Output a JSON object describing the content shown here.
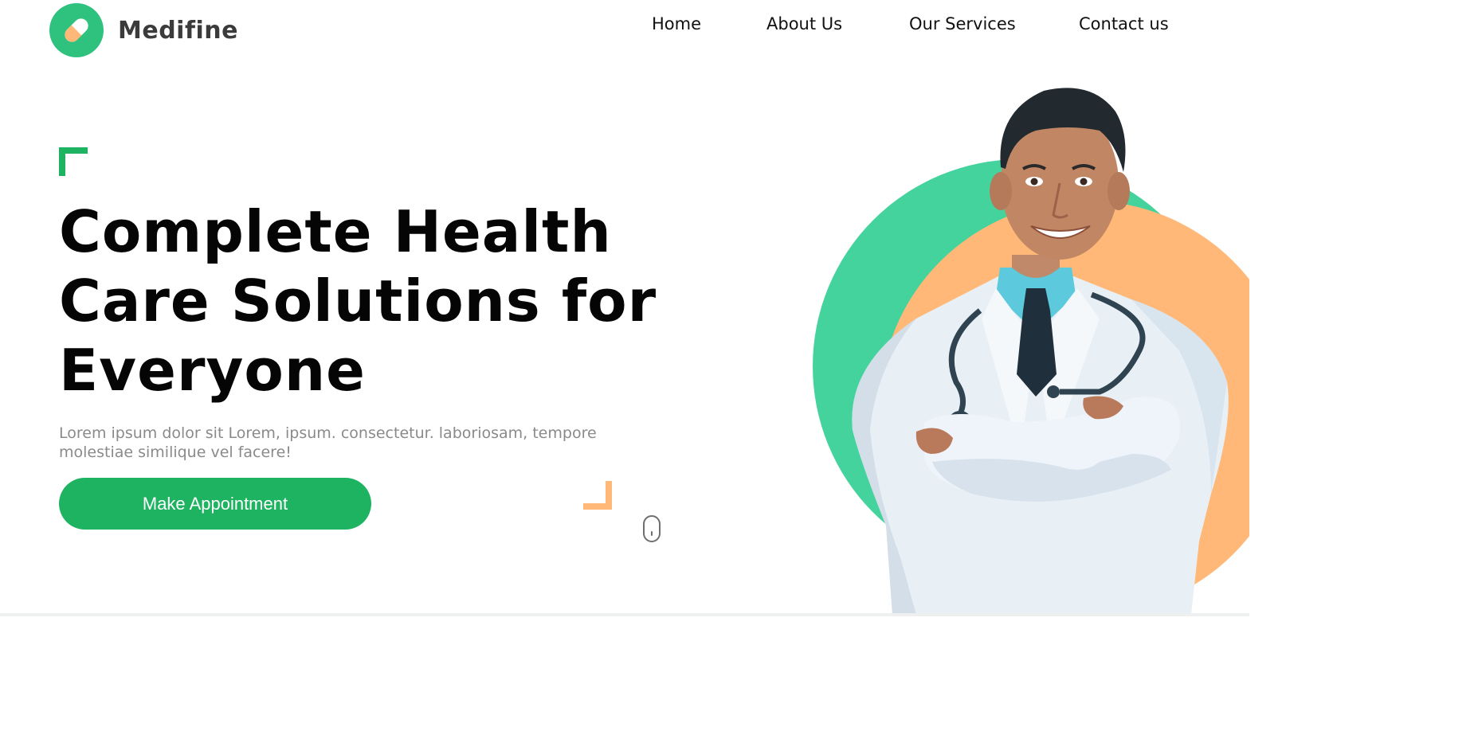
{
  "brand": {
    "name": "Medifine"
  },
  "nav": [
    {
      "label": "Home"
    },
    {
      "label": "About Us"
    },
    {
      "label": "Our Services"
    },
    {
      "label": "Contact us"
    }
  ],
  "hero": {
    "title": "Complete Health Care Solutions for Everyone",
    "subtitle": "Lorem ipsum dolor sit Lorem, ipsum. consectetur. laboriosam, tempore molestiae similique vel facere!",
    "cta_label": "Make Appointment"
  },
  "colors": {
    "brand_green": "#1db360",
    "circle_green": "#44d39c",
    "accent_orange": "#ffb877",
    "title_text": "#050505",
    "body_text": "#8a8a8a"
  },
  "icons": {
    "logo": "pill-icon",
    "scroll": "mouse-scroll-icon"
  }
}
